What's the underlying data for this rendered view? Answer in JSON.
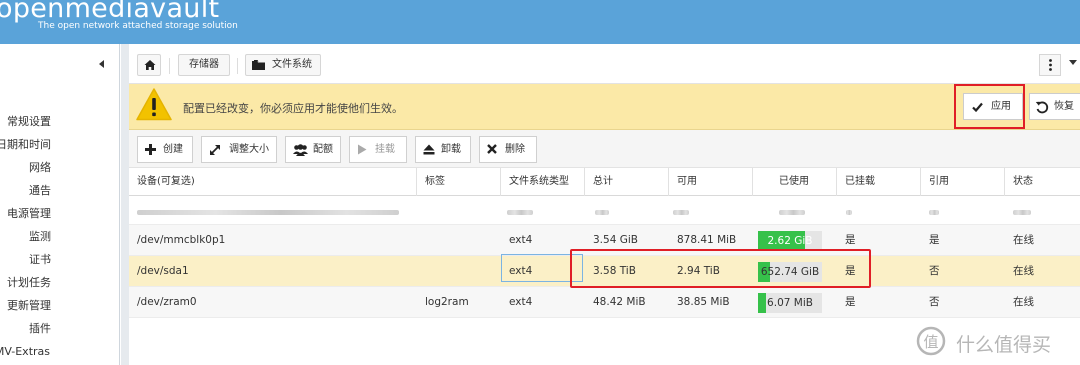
{
  "header": {
    "brand": "openmediavault",
    "tagline": "The open network attached storage solution"
  },
  "sidebar": {
    "items": [
      {
        "label": "常规设置"
      },
      {
        "label": "日期和时间"
      },
      {
        "label": "网络"
      },
      {
        "label": "通告"
      },
      {
        "label": "电源管理"
      },
      {
        "label": "监测"
      },
      {
        "label": "证书"
      },
      {
        "label": "计划任务"
      },
      {
        "label": "更新管理"
      },
      {
        "label": "插件"
      },
      {
        "label": "OMV-Extras"
      }
    ]
  },
  "breadcrumb": {
    "storage": "存储器",
    "filesystems": "文件系统"
  },
  "notice": {
    "message": "配置已经改变，你必须应用才能使他们生效。",
    "apply": "应用",
    "revert": "恢复"
  },
  "actions": {
    "create": "创建",
    "resize": "调整大小",
    "quota": "配额",
    "mount": "挂载",
    "unmount": "卸载",
    "delete": "删除"
  },
  "table": {
    "columns": [
      "设备(可复选)",
      "标签",
      "文件系统类型",
      "总计",
      "可用",
      "已使用",
      "已挂载",
      "引用",
      "状态"
    ],
    "rows": [
      {
        "device": "/dev/mmcblk0p1",
        "label": "",
        "type": "ext4",
        "total": "3.54 GiB",
        "available": "878.41 MiB",
        "used": "2.62 GiB",
        "used_fraction": 0.74,
        "mounted": "是",
        "referenced": "是",
        "status": "在线"
      },
      {
        "device": "/dev/sda1",
        "label": "",
        "type": "ext4",
        "total": "3.58 TiB",
        "available": "2.94 TiB",
        "used": "652.74 GiB",
        "used_fraction": 0.18,
        "mounted": "是",
        "referenced": "否",
        "status": "在线"
      },
      {
        "device": "/dev/zram0",
        "label": "log2ram",
        "type": "ext4",
        "total": "48.42 MiB",
        "available": "38.85 MiB",
        "used": "6.07 MiB",
        "used_fraction": 0.13,
        "mounted": "是",
        "referenced": "否",
        "status": "在线"
      }
    ]
  },
  "watermark": {
    "text": "什么值得买"
  },
  "colors": {
    "header": "#5aa3d9",
    "notice": "#fbe9a7",
    "usage": "#36c14a",
    "highlight": "#e01e26"
  }
}
